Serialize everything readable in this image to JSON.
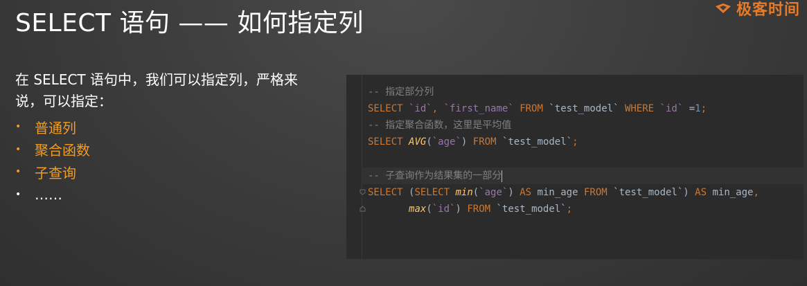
{
  "slide": {
    "title": "SELECT 语句 —— 如何指定列",
    "brand": "极客时间",
    "intro": "在 SELECT 语句中，我们可以指定列，严格来说，可以指定：",
    "bullets": [
      {
        "text": "普通列",
        "color": "#f39c1f"
      },
      {
        "text": "聚合函数",
        "color": "#f39c1f"
      },
      {
        "text": "子查询",
        "color": "#f39c1f"
      },
      {
        "text": "……",
        "color": "#ffffff"
      }
    ],
    "accent_color": "#f39c1f"
  },
  "code": {
    "comment1": "-- 指定部分列",
    "comment2": "-- 指定聚合函数，这里是平均值",
    "comment3": "-- 子查询作为结果集的一部分"
  }
}
